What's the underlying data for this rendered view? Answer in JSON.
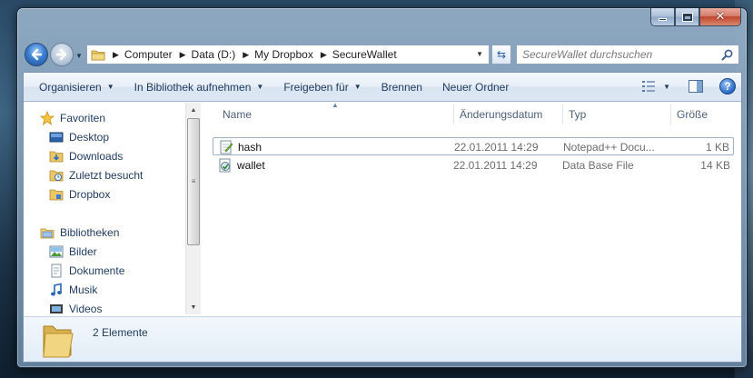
{
  "window": {
    "caption": {
      "minimize": "–",
      "maximize": "□",
      "close": "✕"
    }
  },
  "nav": {
    "breadcrumb": [
      "Computer",
      "Data (D:)",
      "My Dropbox",
      "SecureWallet"
    ],
    "search_placeholder": "SecureWallet durchsuchen"
  },
  "toolbar": {
    "items": [
      "Organisieren",
      "In Bibliothek aufnehmen",
      "Freigeben für",
      "Brennen",
      "Neuer Ordner"
    ]
  },
  "navpane": {
    "favorites": {
      "label": "Favoriten",
      "items": [
        "Desktop",
        "Downloads",
        "Zuletzt besucht",
        "Dropbox"
      ]
    },
    "libraries": {
      "label": "Bibliotheken",
      "items": [
        "Bilder",
        "Dokumente",
        "Musik",
        "Videos"
      ]
    }
  },
  "filelist": {
    "columns": [
      "Name",
      "Änderungsdatum",
      "Typ",
      "Größe"
    ],
    "rows": [
      {
        "name": "hash",
        "modified": "22.01.2011 14:29",
        "type": "Notepad++ Docu...",
        "size": "1 KB"
      },
      {
        "name": "wallet",
        "modified": "22.01.2011 14:29",
        "type": "Data Base File",
        "size": "14 KB"
      }
    ]
  },
  "details": {
    "item_count": "2 Elemente"
  },
  "colors": {
    "accent": "#1e395b",
    "toolbar_top": "#f5f9fd",
    "toolbar_bottom": "#dce7f3",
    "selection_border": "#9fb0c6"
  }
}
